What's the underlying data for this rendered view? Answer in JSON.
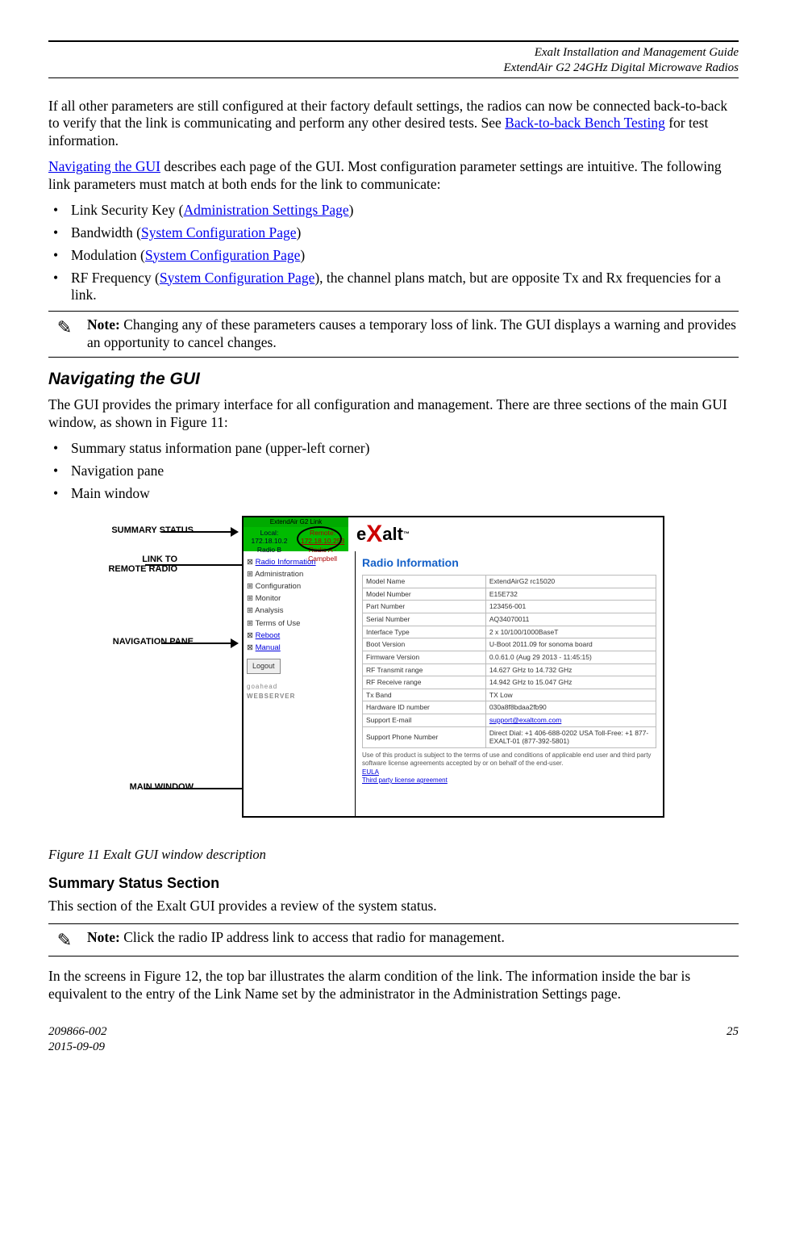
{
  "header": {
    "line1": "Exalt Installation and Management Guide",
    "line2": "ExtendAir G2 24GHz Digital Microwave Radios"
  },
  "para1_a": "If all other parameters are still configured at their factory default settings, the radios can now be connected back-to-back to verify that the link is communicating and perform any other desired tests. See ",
  "para1_link": "Back-to-back Bench Testing",
  "para1_b": " for test information.",
  "para2_link": "Navigating the GUI",
  "para2_b": " describes each page of the GUI. Most configuration parameter settings are intuitive. The following link parameters must match at both ends for the link to communicate:",
  "bullets1": {
    "b1_a": "Link Security Key (",
    "b1_link": "Administration Settings Page",
    "b1_b": ")",
    "b2_a": "Bandwidth (",
    "b2_link": "System Configuration Page",
    "b2_b": ")",
    "b3_a": "Modulation (",
    "b3_link": "System Configuration Page",
    "b3_b": ")",
    "b4_a": "RF Frequency (",
    "b4_link": "System Configuration Page",
    "b4_b": "), the channel plans match, but are opposite Tx and Rx frequencies for a link."
  },
  "note1_label": "Note:",
  "note1_text": " Changing any of these parameters causes a temporary loss of link. The GUI displays a warning and provides an opportunity to cancel changes.",
  "h2": "Navigating the GUI",
  "para3": "The GUI provides the primary interface for all configuration and management. There are three sections of the main GUI window, as shown in Figure 11:",
  "bullets2": {
    "b1": "Summary status information pane (upper-left corner)",
    "b2": "Navigation pane",
    "b3": "Main window"
  },
  "callouts": {
    "summary": "SUMMARY STATUS",
    "linkto_l1": "LINK TO",
    "linkto_l2": "REMOTE RADIO",
    "navpane": "NAVIGATION PANE",
    "mainwin": "MAIN WINDOW"
  },
  "gui": {
    "linkname": "ExtendAir G2 Link",
    "local_label": "Local:",
    "local_ip": "172.18.10.2",
    "local_name": "Radio B",
    "remote_label": "Remote:",
    "remote_ip": "172.18.10.253",
    "remote_name_l1": "Radio A -",
    "remote_name_l2": "Campbell",
    "logo_text_a": "e",
    "logo_text_b": "alt",
    "nav_items": {
      "radioinfo": "Radio Information",
      "admin": "Administration",
      "config": "Configuration",
      "monitor": "Monitor",
      "analysis": "Analysis",
      "terms": "Terms of Use",
      "reboot": "Reboot",
      "manual": "Manual",
      "logout": "Logout",
      "webserver": "WEBSERVER"
    },
    "main_title": "Radio Information",
    "rows": [
      {
        "k": "Model Name",
        "v": "ExtendAirG2 rc15020"
      },
      {
        "k": "Model Number",
        "v": "E15E732"
      },
      {
        "k": "Part Number",
        "v": "123456-001"
      },
      {
        "k": "Serial Number",
        "v": "AQ34070011"
      },
      {
        "k": "Interface Type",
        "v": "2 x 10/100/1000BaseT"
      },
      {
        "k": "Boot Version",
        "v": "U-Boot 2011.09 for sonoma board"
      },
      {
        "k": "Firmware Version",
        "v": "0.0.61.0 (Aug 29 2013 - 11:45:15)"
      },
      {
        "k": "RF Transmit range",
        "v": "14.627 GHz to 14.732 GHz"
      },
      {
        "k": "RF Receive range",
        "v": "14.942 GHz to 15.047 GHz"
      },
      {
        "k": "Tx Band",
        "v": "TX Low"
      },
      {
        "k": "Hardware ID number",
        "v": "030a8f8bdaa2fb90"
      },
      {
        "k": "Support E-mail",
        "v": "support@exaltcom.com"
      },
      {
        "k": "Support Phone Number",
        "v": "Direct Dial: +1 406-688-0202\nUSA Toll-Free: +1 877-EXALT-01 (877-392-5801)"
      }
    ],
    "foot_text": "Use of this product is subject to the terms of use and conditions of applicable end user and third party software license agreements accepted by or on behalf of the end-user.",
    "foot_link1": "EULA",
    "foot_link2": "Third party license agreement"
  },
  "fig_caption": "Figure 11   Exalt GUI window description",
  "h3": "Summary Status Section",
  "para4": "This section of the Exalt GUI provides a review of the system status.",
  "note2_label": "Note:",
  "note2_text": " Click the radio IP address link to access that radio for management.",
  "para5": "In the screens in Figure 12, the top bar illustrates the alarm condition of the link. The information inside the bar is equivalent to the entry of the Link Name set by the administrator in the Administration Settings page.",
  "footer": {
    "docnum": "209866-002",
    "date": "2015-09-09",
    "page": "25"
  }
}
